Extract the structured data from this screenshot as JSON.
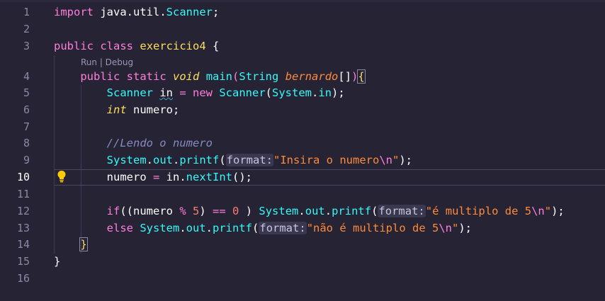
{
  "editor": {
    "codelens": "Run | Debug",
    "active_line": 10,
    "lines": [
      {
        "n": "1",
        "tokens": [
          [
            "import",
            "t-pink"
          ],
          [
            " java.util.",
            "t-id"
          ],
          [
            "Scanner",
            "t-cyan"
          ],
          [
            ";",
            "t-id"
          ]
        ]
      },
      {
        "n": "2",
        "tokens": []
      },
      {
        "n": "3",
        "tokens": [
          [
            "public",
            "t-pink"
          ],
          [
            " ",
            "t-id"
          ],
          [
            "class",
            "t-pink"
          ],
          [
            " ",
            "t-id"
          ],
          [
            "exercicio4",
            "t-yel"
          ],
          [
            " {",
            "t-id"
          ]
        ]
      },
      {
        "n": "4",
        "tokens": [
          [
            "    ",
            "t-id"
          ],
          [
            "public",
            "t-pink"
          ],
          [
            " ",
            "t-id"
          ],
          [
            "static",
            "t-pink"
          ],
          [
            " ",
            "t-id"
          ],
          [
            "void",
            "t-it"
          ],
          [
            " ",
            "t-id"
          ],
          [
            "main",
            "t-cyan"
          ],
          [
            "(",
            "t-pink"
          ],
          [
            "String",
            "t-cyan"
          ],
          [
            " ",
            "t-id"
          ],
          [
            "bernardo",
            "t-orange-it"
          ],
          [
            "[]",
            "t-id"
          ],
          [
            ")",
            "t-pink"
          ],
          [
            "{",
            "t-box"
          ]
        ]
      },
      {
        "n": "5",
        "tokens": [
          [
            "        ",
            "t-id"
          ],
          [
            "Scanner",
            "t-cyan"
          ],
          [
            " ",
            "t-id"
          ],
          [
            "in",
            "t-squig"
          ],
          [
            " = ",
            "t-pink"
          ],
          [
            "new",
            "t-pink"
          ],
          [
            " ",
            "t-id"
          ],
          [
            "Scanner",
            "t-cyan"
          ],
          [
            "(",
            "t-id"
          ],
          [
            "System",
            "t-cyan"
          ],
          [
            ".",
            "t-id"
          ],
          [
            "in",
            "t-cyan"
          ],
          [
            ");",
            "t-id"
          ]
        ]
      },
      {
        "n": "6",
        "tokens": [
          [
            "        ",
            "t-id"
          ],
          [
            "int",
            "t-it"
          ],
          [
            " numero;",
            "t-id"
          ]
        ]
      },
      {
        "n": "7",
        "tokens": []
      },
      {
        "n": "8",
        "tokens": [
          [
            "        ",
            "t-id"
          ],
          [
            "//Lendo o numero",
            "t-cm"
          ]
        ]
      },
      {
        "n": "9",
        "tokens": [
          [
            "        ",
            "t-id"
          ],
          [
            "System",
            "t-cyan"
          ],
          [
            ".",
            "t-id"
          ],
          [
            "out",
            "t-cyan"
          ],
          [
            ".",
            "t-id"
          ],
          [
            "printf",
            "t-cyan"
          ],
          [
            "(",
            "t-id"
          ],
          [
            "format:",
            "t-hint"
          ],
          [
            "\"Insira o numero",
            "t-orange"
          ],
          [
            "\\n",
            "t-pink"
          ],
          [
            "\"",
            "t-orange"
          ],
          [
            ");",
            "t-id"
          ]
        ]
      },
      {
        "n": "10",
        "tokens": [
          [
            "        ",
            "t-id"
          ],
          [
            "numero",
            "t-id"
          ],
          [
            " = ",
            "t-pink"
          ],
          [
            "in",
            "t-id"
          ],
          [
            ".",
            "t-id"
          ],
          [
            "nextInt",
            "t-cyan"
          ],
          [
            "();",
            "t-id"
          ]
        ]
      },
      {
        "n": "11",
        "tokens": []
      },
      {
        "n": "12",
        "tokens": [
          [
            "        ",
            "t-id"
          ],
          [
            "if",
            "t-pink"
          ],
          [
            "((numero ",
            "t-id"
          ],
          [
            "%",
            "t-pink"
          ],
          [
            " ",
            "t-id"
          ],
          [
            "5",
            "t-num"
          ],
          [
            ") ",
            "t-id"
          ],
          [
            "==",
            "t-pink"
          ],
          [
            " ",
            "t-id"
          ],
          [
            "0",
            "t-num"
          ],
          [
            " ) ",
            "t-id"
          ],
          [
            "System",
            "t-cyan"
          ],
          [
            ".",
            "t-id"
          ],
          [
            "out",
            "t-cyan"
          ],
          [
            ".",
            "t-id"
          ],
          [
            "printf",
            "t-cyan"
          ],
          [
            "(",
            "t-id"
          ],
          [
            "format:",
            "t-hint"
          ],
          [
            "\"é multiplo de 5",
            "t-orange"
          ],
          [
            "\\n",
            "t-pink"
          ],
          [
            "\"",
            "t-orange"
          ],
          [
            ");",
            "t-id"
          ]
        ]
      },
      {
        "n": "13",
        "tokens": [
          [
            "        ",
            "t-id"
          ],
          [
            "else",
            "t-pink"
          ],
          [
            " ",
            "t-id"
          ],
          [
            "System",
            "t-cyan"
          ],
          [
            ".",
            "t-id"
          ],
          [
            "out",
            "t-cyan"
          ],
          [
            ".",
            "t-id"
          ],
          [
            "printf",
            "t-cyan"
          ],
          [
            "(",
            "t-id"
          ],
          [
            "format:",
            "t-hint"
          ],
          [
            "\"não é multiplo de 5",
            "t-orange"
          ],
          [
            "\\n",
            "t-pink"
          ],
          [
            "\"",
            "t-orange"
          ],
          [
            ");",
            "t-id"
          ]
        ]
      },
      {
        "n": "14",
        "tokens": [
          [
            "    ",
            "t-id"
          ],
          [
            "}",
            "t-box"
          ]
        ]
      },
      {
        "n": "15",
        "tokens": [
          [
            "}",
            "t-id"
          ]
        ]
      },
      {
        "n": "16",
        "tokens": []
      }
    ]
  },
  "icons": {
    "lightbulb": "lightbulb-icon"
  },
  "colors": {
    "background": "#262335",
    "keyword": "#ff7edb",
    "type": "#36f9f6",
    "string": "#ff8b39",
    "number": "#f97e72",
    "comment": "#848bbd",
    "class_name": "#fede5d"
  }
}
